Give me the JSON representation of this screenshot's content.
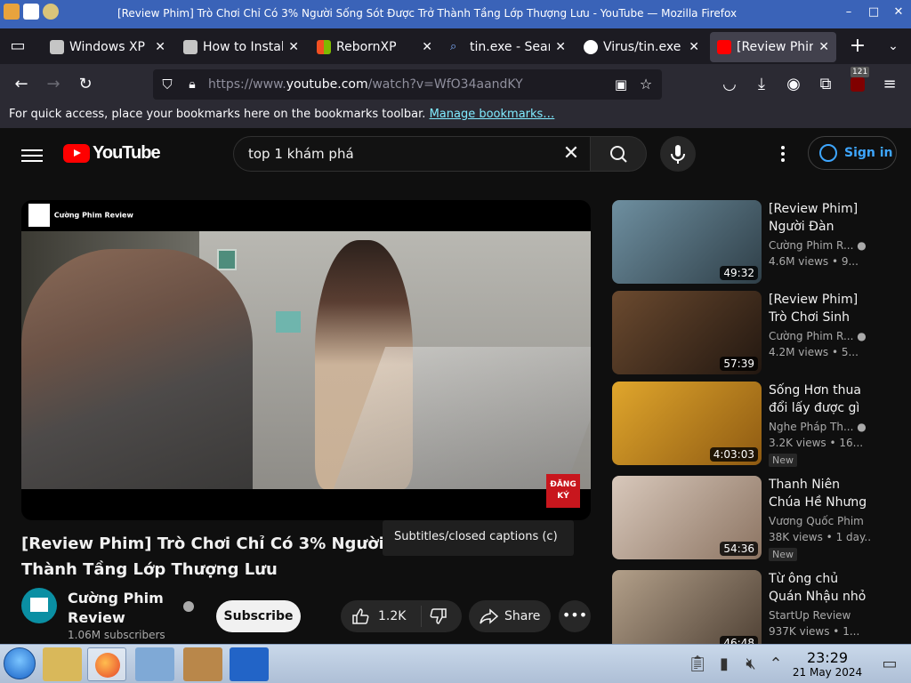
{
  "window": {
    "title": "[Review Phim] Trò Chơi Chỉ Có 3% Người Sống Sót Được Trở Thành Tầng Lớp Thượng Lưu - YouTube — Mozilla Firefox"
  },
  "tabs": [
    {
      "label": "Windows XP S",
      "icon": "page-icon"
    },
    {
      "label": "How to Install",
      "icon": "page-icon"
    },
    {
      "label": "RebornXP",
      "icon": "windows-flag-icon"
    },
    {
      "label": "tin.exe - Sear",
      "icon": "search-icon"
    },
    {
      "label": "Virus/tin.exe",
      "icon": "github-icon"
    },
    {
      "label": "[Review Phim",
      "icon": "youtube-icon",
      "active": true
    }
  ],
  "navbar": {
    "url_prefix": "https://www.",
    "url_domain": "youtube.com",
    "url_path": "/watch?v=WfO34aandKY",
    "extensions_badge": "121"
  },
  "bookmarks_bar": {
    "message": "For quick access, place your bookmarks here on the bookmarks toolbar.",
    "link": "Manage bookmarks…"
  },
  "youtube": {
    "logo_text": "YouTube",
    "search_query": "top 1 khám phá",
    "sign_in": "Sign in",
    "player": {
      "channel_watermark": "Cường Phim Review",
      "subscribe_overlay": "ĐĂNG KÝ"
    },
    "tooltip": "Subtitles/closed captions (c)",
    "video_title": "[Review Phim] Trò Chơi Chỉ Có 3% Người Sống Sót Được Trở Thành Tầng Lớp Thượng Lưu",
    "channel": {
      "name": "Cường Phim Review",
      "subscribers": "1.06M subscribers"
    },
    "subscribe_label": "Subscribe",
    "likes": "1.2K",
    "share_label": "Share",
    "recommendations": [
      {
        "title": "[Review Phim] Người Đàn Ông...",
        "channel": "Cường Phim R...",
        "views": "4.6M views",
        "age": "9...",
        "duration": "49:32",
        "verified": true,
        "new": "",
        "thumb_color": "#3c5a6b"
      },
      {
        "title": "[Review Phim] Trò Chơi Sinh T...",
        "channel": "Cường Phim R...",
        "views": "4.2M views",
        "age": "5...",
        "duration": "57:39",
        "verified": true,
        "new": "",
        "thumb_color": "#4a3424"
      },
      {
        "title": "Sống Hơn thua đổi lấy được gì ...",
        "channel": "Nghe Pháp Th...",
        "views": "3.2K views",
        "age": "16...",
        "duration": "4:03:03",
        "verified": true,
        "new": "New",
        "thumb_color": "#c98a1f"
      },
      {
        "title": "Thanh Niên Chúa Hề Nhưng Lại Bị...",
        "channel": "Vương Quốc Phim ...",
        "views": "38K views",
        "age": "1 day...",
        "duration": "54:36",
        "verified": false,
        "new": "New",
        "thumb_color": "#c8b5a6"
      },
      {
        "title": "Từ ông chủ Quán Nhậu nhỏ ở...",
        "channel": "StartUp Review",
        "views": "937K views",
        "age": "1...",
        "duration": "46:48",
        "verified": false,
        "new": "",
        "thumb_color": "#8d7c6a"
      }
    ]
  },
  "taskbar": {
    "time": "23:29",
    "date": "21 May 2024"
  }
}
